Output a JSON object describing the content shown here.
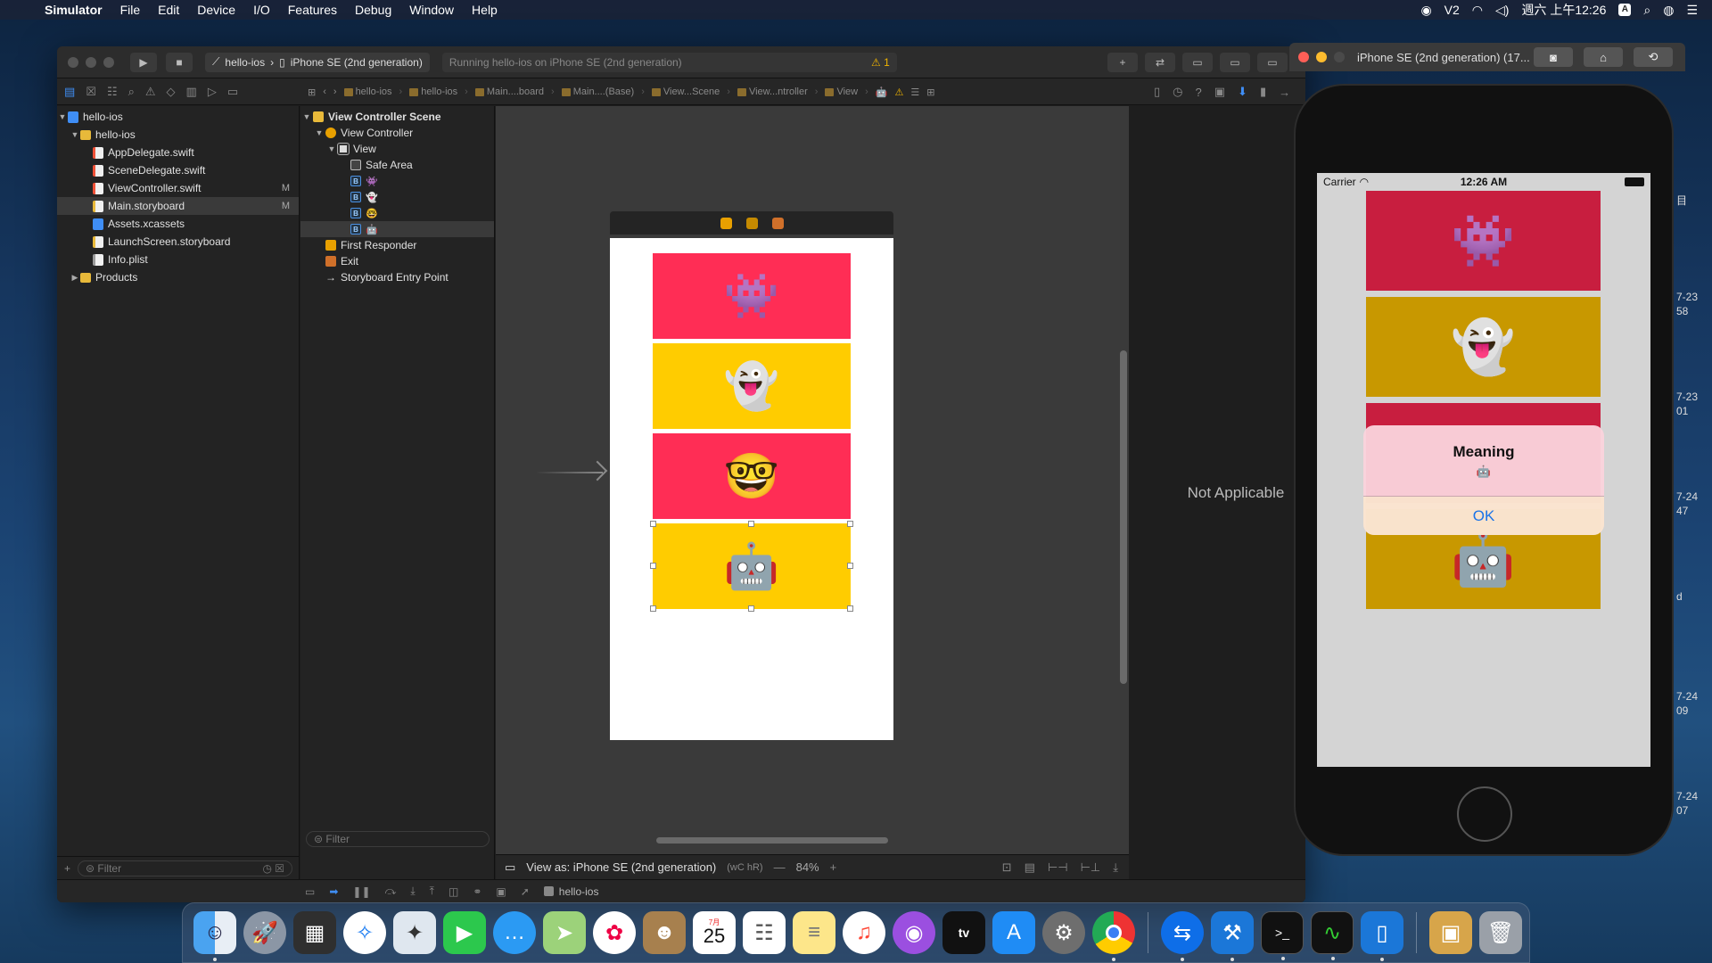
{
  "menubar": {
    "apple": "",
    "items": [
      "Simulator",
      "File",
      "Edit",
      "Device",
      "I/O",
      "Features",
      "Debug",
      "Window",
      "Help"
    ],
    "clock": "週六 上午12:26",
    "input_label": "A"
  },
  "xcode": {
    "scheme": "hello-ios",
    "destination": "iPhone SE (2nd generation)",
    "activity": "Running hello-ios on iPhone SE (2nd generation)",
    "warning_count": "1",
    "jumpbar": [
      "hello-ios",
      "hello-ios",
      "Main....board",
      "Main....(Base)",
      "View...Scene",
      "View...ntroller",
      "View"
    ],
    "navigator": {
      "project": "hello-ios",
      "group": "hello-ios",
      "files": [
        {
          "name": "AppDelegate.swift",
          "badge": ""
        },
        {
          "name": "SceneDelegate.swift",
          "badge": ""
        },
        {
          "name": "ViewController.swift",
          "badge": "M"
        },
        {
          "name": "Main.storyboard",
          "badge": "M"
        },
        {
          "name": "Assets.xcassets",
          "badge": ""
        },
        {
          "name": "LaunchScreen.storyboard",
          "badge": ""
        },
        {
          "name": "Info.plist",
          "badge": ""
        }
      ],
      "products": "Products",
      "filter_placeholder": "Filter"
    },
    "outline": {
      "scene": "View Controller Scene",
      "controller": "View Controller",
      "view": "View",
      "safe_area": "Safe Area",
      "buttons": [
        "👾",
        "👻",
        "🤓",
        "🤖"
      ],
      "first_responder": "First Responder",
      "exit": "Exit",
      "entry_point": "Storyboard Entry Point",
      "filter_placeholder": "Filter"
    },
    "canvas": {
      "buttons": [
        "👾",
        "👻",
        "🤓",
        "🤖"
      ],
      "view_as": "View as: iPhone SE (2nd generation)",
      "size_class": "(wC hR)",
      "zoom": "84%"
    },
    "inspector": {
      "message": "Not Applicable"
    },
    "debug_bar_label": "hello-ios"
  },
  "simulator": {
    "title": "iPhone SE (2nd generation) (17...",
    "status": {
      "carrier": "Carrier",
      "time": "12:26 AM"
    },
    "buttons": [
      "👾",
      "👻",
      "",
      "🤖"
    ],
    "alert": {
      "title": "Meaning",
      "message": "🤖",
      "ok": "OK"
    }
  },
  "background_peek": [
    "目",
    "7-23",
    "58",
    "7-23",
    "01",
    "7-24",
    "47",
    "d",
    "7-24",
    "09",
    "7-24",
    "07"
  ],
  "dock": {
    "date_label": "25",
    "month_label": "7月"
  }
}
